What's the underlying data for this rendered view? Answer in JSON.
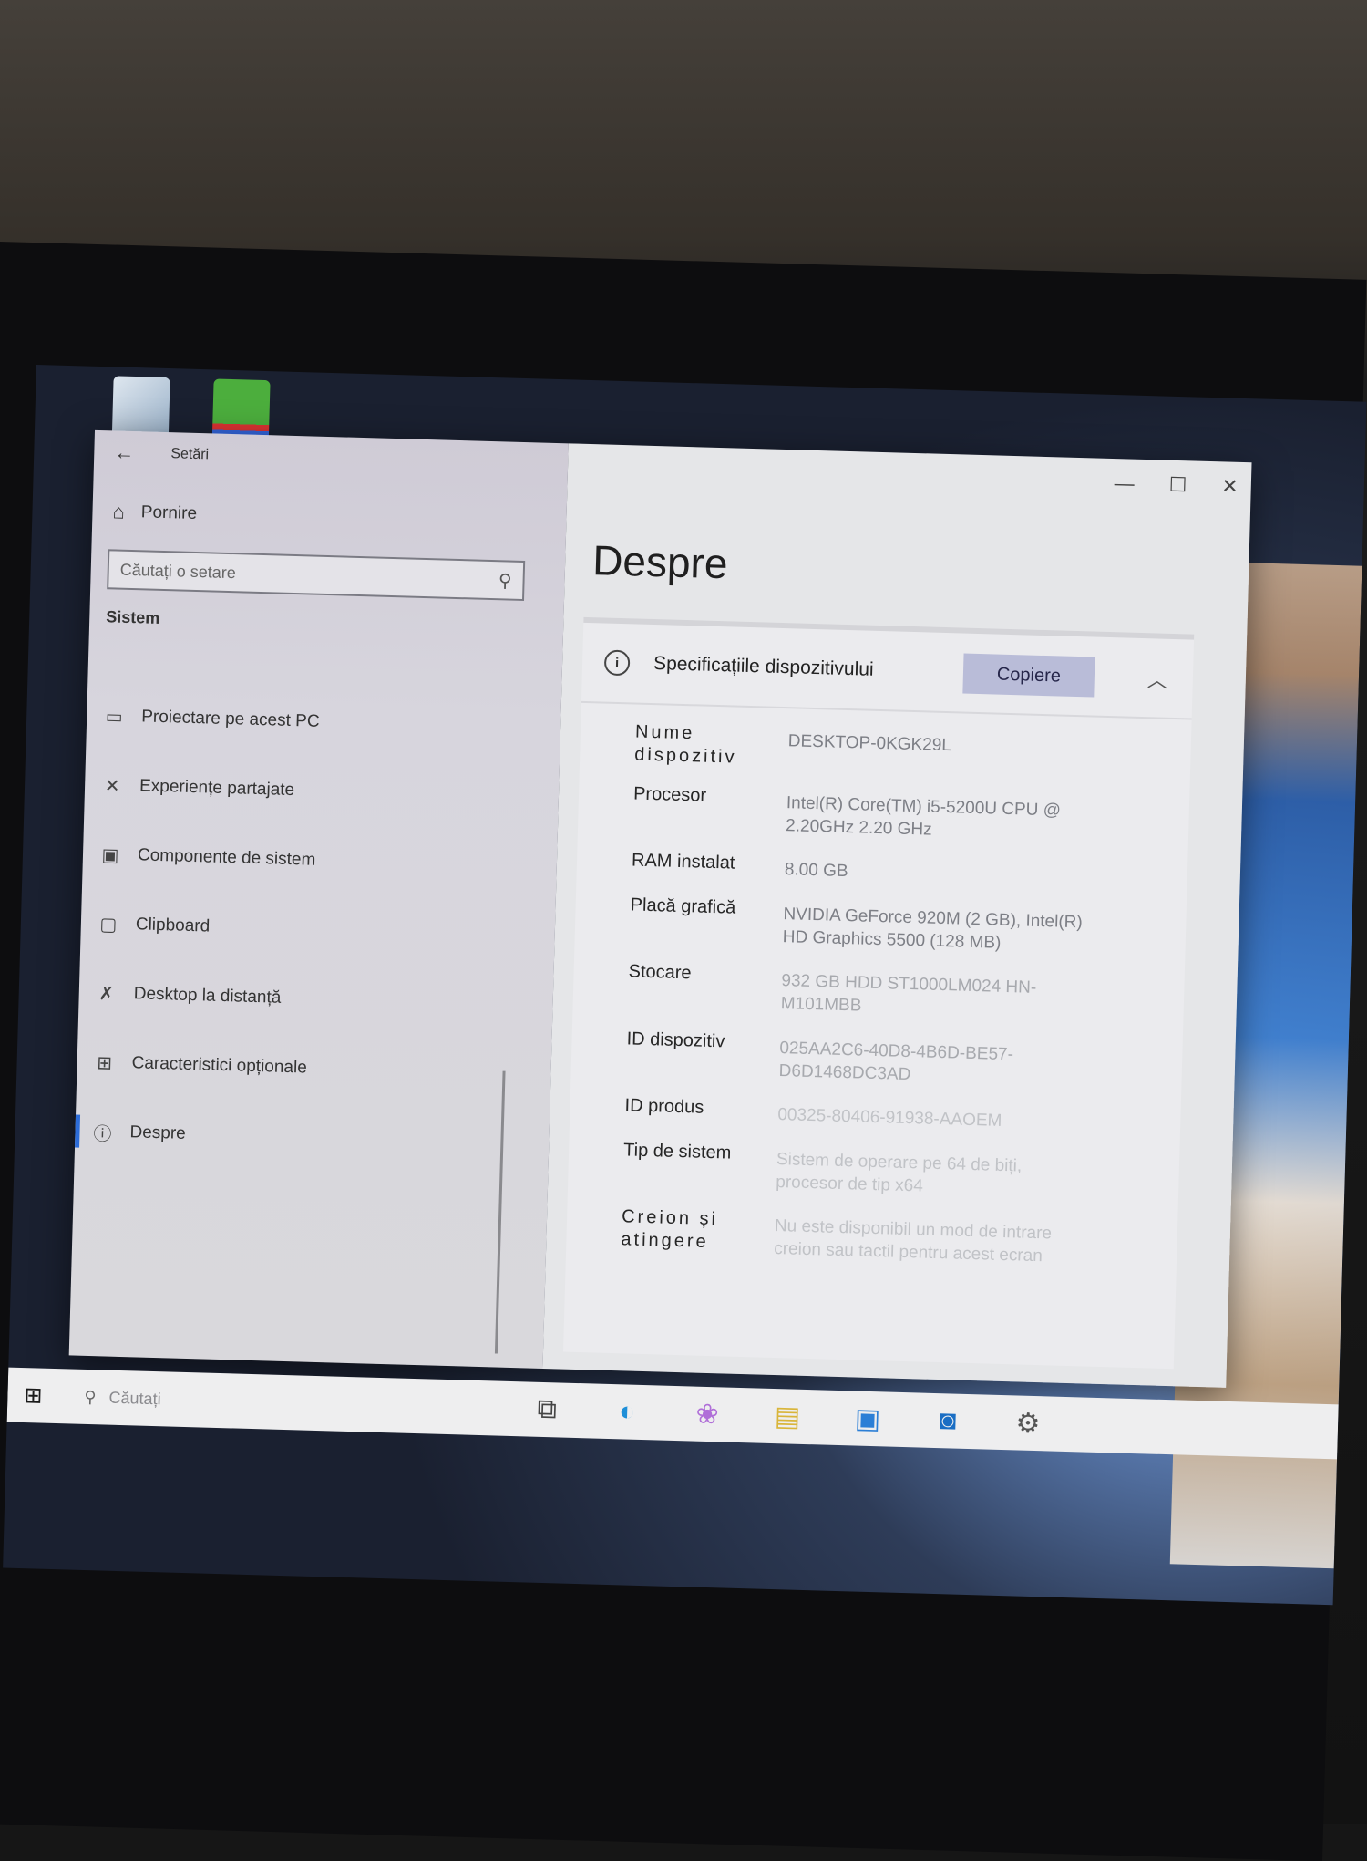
{
  "settings": {
    "title": "Setări",
    "home_label": "Pornire",
    "search_placeholder": "Căutați o setare",
    "group_label": "Sistem",
    "nav_items": [
      {
        "label": "Proiectare pe acest PC",
        "icon": "projector-icon"
      },
      {
        "label": "Experiențe partajate",
        "icon": "shared-experiences-icon"
      },
      {
        "label": "Componente de sistem",
        "icon": "system-components-icon"
      },
      {
        "label": "Clipboard",
        "icon": "clipboard-icon"
      },
      {
        "label": "Desktop la distanță",
        "icon": "remote-desktop-icon"
      },
      {
        "label": "Caracteristici opționale",
        "icon": "optional-features-icon"
      },
      {
        "label": "Despre",
        "icon": "info-icon",
        "active": true
      }
    ]
  },
  "about": {
    "page_title": "Despre",
    "card_title": "Specificațiile dispozitivului",
    "copy_button": "Copiere",
    "specs": [
      {
        "label": "Nume dispozitiv",
        "value": "DESKTOP-0KGK29L"
      },
      {
        "label": "Procesor",
        "value": "Intel(R) Core(TM) i5-5200U CPU @ 2.20GHz 2.20 GHz"
      },
      {
        "label": "RAM instalat",
        "value": "8.00 GB"
      },
      {
        "label": "Placă grafică",
        "value": "NVIDIA GeForce 920M (2 GB), Intel(R) HD Graphics 5500 (128 MB)"
      },
      {
        "label": "Stocare",
        "value": "932 GB HDD ST1000LM024 HN-M101MBB"
      },
      {
        "label": "ID dispozitiv",
        "value": "025AA2C6-40D8-4B6D-BE57-D6D1468DC3AD"
      },
      {
        "label": "ID produs",
        "value": "00325-80406-91938-AAOEM"
      },
      {
        "label": "Tip de sistem",
        "value": "Sistem de operare pe 64 de biți, procesor de tip x64"
      },
      {
        "label": "Creion și atingere",
        "value": "Nu este disponibil un mod de intrare creion sau tactil pentru acest ecran"
      }
    ]
  },
  "taskbar": {
    "search_placeholder": "Căutați",
    "icons": [
      "task-view-icon",
      "edge-icon",
      "photos-icon",
      "file-explorer-icon",
      "store-icon",
      "outlook-icon",
      "settings-icon"
    ]
  },
  "desktop": {
    "icons": [
      "recycle-bin-icon",
      "shortcut-app-icon"
    ]
  },
  "colors": {
    "accent": "#2c6cd8",
    "copy_button_bg": "#b9bcd8"
  }
}
